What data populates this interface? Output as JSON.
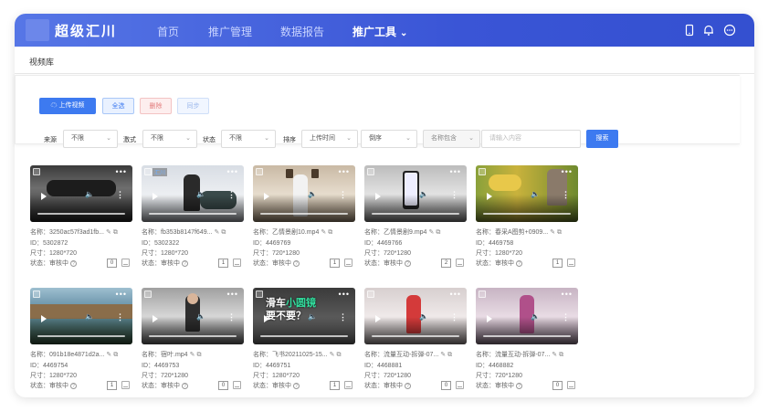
{
  "app": {
    "brand": "超级汇川",
    "nav": [
      {
        "label": "首页",
        "active": false
      },
      {
        "label": "推广管理",
        "active": false
      },
      {
        "label": "数据报告",
        "active": false
      },
      {
        "label": "推广工具",
        "active": true
      }
    ],
    "top_icons": [
      "phone-icon",
      "bell-icon",
      "more-circle-icon"
    ]
  },
  "breadcrumb": "视频库",
  "toolbar": {
    "upload_label": "上传视频",
    "select_all_label": "全选",
    "delete_label": "删除",
    "sync_label": "同步"
  },
  "filters": {
    "source_label": "来源",
    "source_value": "不限",
    "copy_label": "激式",
    "copy_value": "不限",
    "status_label": "状态",
    "status_value": "不限",
    "sort_label": "排序",
    "sort_value": "上传时间",
    "order_value": "倒序",
    "name_match_value": "名称包含",
    "search_placeholder": "请输入内容",
    "search_button": "搜索"
  },
  "videos": [
    {
      "name": "名称：3250ac57f3ad1fb...",
      "id": "ID：5302872",
      "size": "尺寸：1280*720",
      "status": "状态：审核中",
      "count": "0",
      "scene": "car",
      "tag": ""
    },
    {
      "name": "名称：fb353b8147f649...",
      "id": "ID：5302322",
      "size": "尺寸：1280*720",
      "status": "状态：审核中",
      "count": "1",
      "scene": "man",
      "tag": "汇川"
    },
    {
      "name": "名称：乙情景剧10.mp4",
      "id": "ID：4469769",
      "size": "尺寸：720*1280",
      "status": "状态：审核中",
      "count": "1",
      "scene": "room",
      "tag": ""
    },
    {
      "name": "名称：乙情景剧9.mp4",
      "id": "ID：4469766",
      "size": "尺寸：720*1280",
      "status": "状态：审核中",
      "count": "2",
      "scene": "phone",
      "tag": ""
    },
    {
      "name": "名称：春采A图剪+0909...",
      "id": "ID：4469758",
      "size": "尺寸：1280*720",
      "status": "状态：审核中",
      "count": "1",
      "scene": "corn",
      "tag": ""
    },
    {
      "name": "名称：091b18e4871d2a...",
      "id": "ID：4469754",
      "size": "尺寸：1280*720",
      "status": "状态：审核中",
      "count": "1",
      "scene": "river",
      "tag": ""
    },
    {
      "name": "名称：宿叶.mp4",
      "id": "ID：4469753",
      "size": "尺寸：720*1280",
      "status": "状态：审核中",
      "count": "0",
      "scene": "tall",
      "tag": ""
    },
    {
      "name": "名称：飞书20211025-15...",
      "id": "ID：4469751",
      "size": "尺寸：1280*720",
      "status": "状态：审核中",
      "count": "1",
      "scene": "text",
      "tag": ""
    },
    {
      "name": "名称：流量互动-拆弹-07...",
      "id": "ID：4468881",
      "size": "尺寸：720*1280",
      "status": "状态：审核中",
      "count": "0",
      "scene": "red",
      "tag": ""
    },
    {
      "name": "名称：流量互动-拆弹-07...",
      "id": "ID：4468882",
      "size": "尺寸：720*1280",
      "status": "状态：审核中",
      "count": "0",
      "scene": "pink",
      "tag": ""
    }
  ],
  "overlay_caption": {
    "line1a": "滑车",
    "line1b": "小圆镜",
    "line2": "要不要？"
  }
}
